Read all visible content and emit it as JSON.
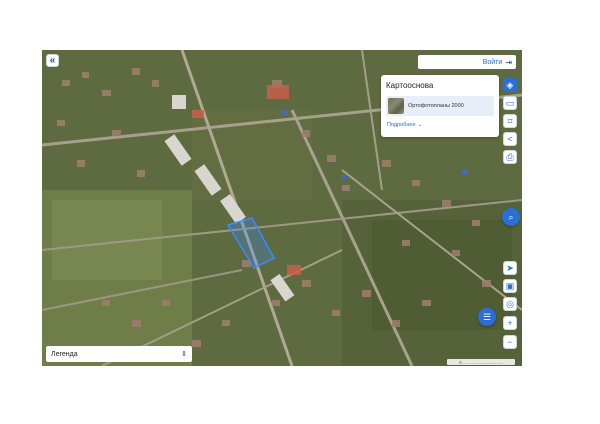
{
  "header": {
    "collapse_icon": "double-chevron-left-icon",
    "login_label": "Войти",
    "login_icon": "login-arrow-icon"
  },
  "basemap_panel": {
    "title": "Картооснова",
    "option_label": "Ортофотопланы 2000",
    "more_label": "Подробнее"
  },
  "toolbar": {
    "tools": [
      {
        "name": "layers",
        "icon": "layers-icon"
      },
      {
        "name": "print-frame",
        "icon": "frame-icon"
      },
      {
        "name": "measure",
        "icon": "measure-icon"
      },
      {
        "name": "share",
        "icon": "share-icon"
      },
      {
        "name": "print",
        "icon": "printer-icon"
      }
    ],
    "lower_tools": [
      {
        "name": "geolocate",
        "icon": "location-arrow-icon"
      },
      {
        "name": "screenshot",
        "icon": "screen-icon"
      },
      {
        "name": "compass",
        "icon": "compass-icon"
      },
      {
        "name": "zoom-in",
        "icon": "plus-icon"
      },
      {
        "name": "zoom-out",
        "icon": "minus-icon"
      }
    ]
  },
  "legend": {
    "label": "Легенда"
  },
  "scale": {
    "text": "© ...................................."
  },
  "colors": {
    "accent": "#2a6fd6",
    "highlight": "#3a8cff"
  }
}
